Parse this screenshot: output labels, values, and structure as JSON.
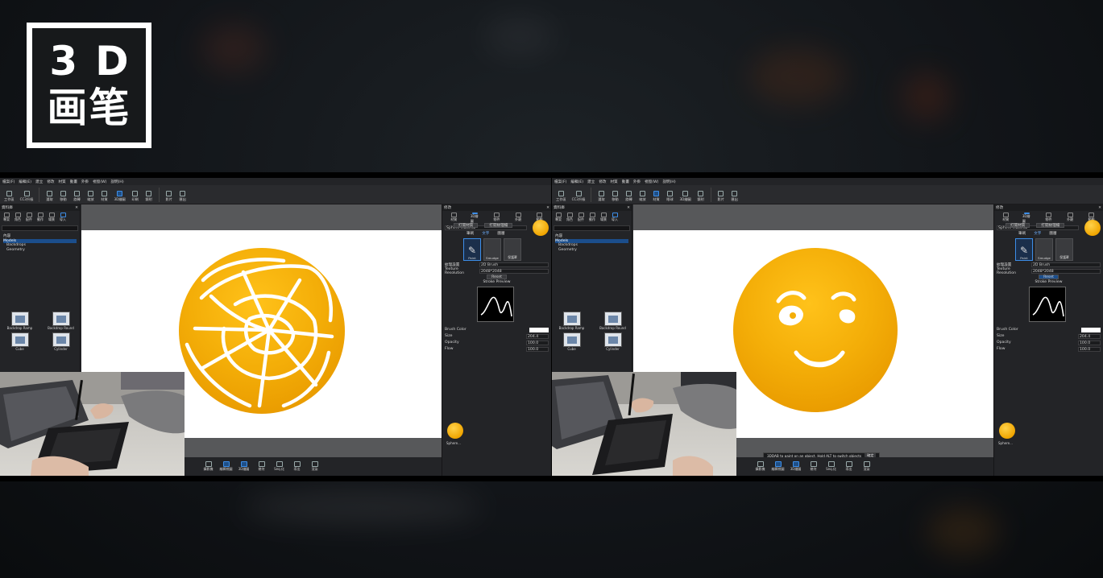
{
  "title": {
    "line1": "3D",
    "line2": "画笔"
  },
  "app": {
    "menu": [
      "檔案(F)",
      "編輯(E)",
      "建立",
      "修改",
      "材質",
      "動畫",
      "外掛",
      "視窗(W)",
      "說明(H)"
    ],
    "toolbar": [
      "工作區",
      "CC3升級",
      "選取",
      "移動",
      "旋轉",
      "縮放",
      "材質",
      "眼球",
      "3D繪圖",
      "印刷",
      "鏡射",
      "影片",
      "匯出"
    ],
    "left_panel": {
      "title": "資料庫",
      "tabs": [
        "專案",
        "角色",
        "配件",
        "動作",
        "場景",
        "導入"
      ],
      "tree": [
        "Models",
        "Backdrops",
        "Geometry"
      ],
      "tree_root": "內容",
      "models": [
        "Backdrop Ramp",
        "Backdrop Round",
        "Cube",
        "Cylinder"
      ]
    },
    "right_panel": {
      "title": "修改",
      "tabs": [
        "材質",
        "3D繪圖",
        "物件",
        "外觀",
        "動態"
      ],
      "material_name": "Sphere Material",
      "buttons": [
        "打開材質",
        "打開紋理檔"
      ],
      "brush_tabs": [
        "筆刷",
        "文字",
        "圖層"
      ],
      "brushes": [
        "Paint",
        "Smudge",
        "保護罩"
      ],
      "fields": {
        "texture_label": "紋理設置",
        "texture_value": "2D Brush",
        "resolution_label": "Texture Resolution",
        "resolution_value": "2048*2048",
        "reset": "Reset",
        "stroke_label": "Stroke Preview",
        "brush_color": "Brush Color",
        "brush_size": "Size",
        "opacity": "Opacity",
        "flow": "Flow",
        "size_value": "204.4",
        "opacity_value": "100.0",
        "flow_value": "100.0"
      },
      "asset": "Sphere..."
    },
    "bottom": [
      "攝影機",
      "編輯視圖",
      "3D繪圖",
      "幾何",
      "Seq.化",
      "導出",
      "渲染"
    ],
    "status_message": "3DDAB to paint on an object. Hold ALT to switch objects",
    "status_ok": "確定"
  },
  "colors": {
    "sphere": "#f4ae08",
    "accent": "#3d8ee8",
    "stroke": "#ffffff"
  }
}
